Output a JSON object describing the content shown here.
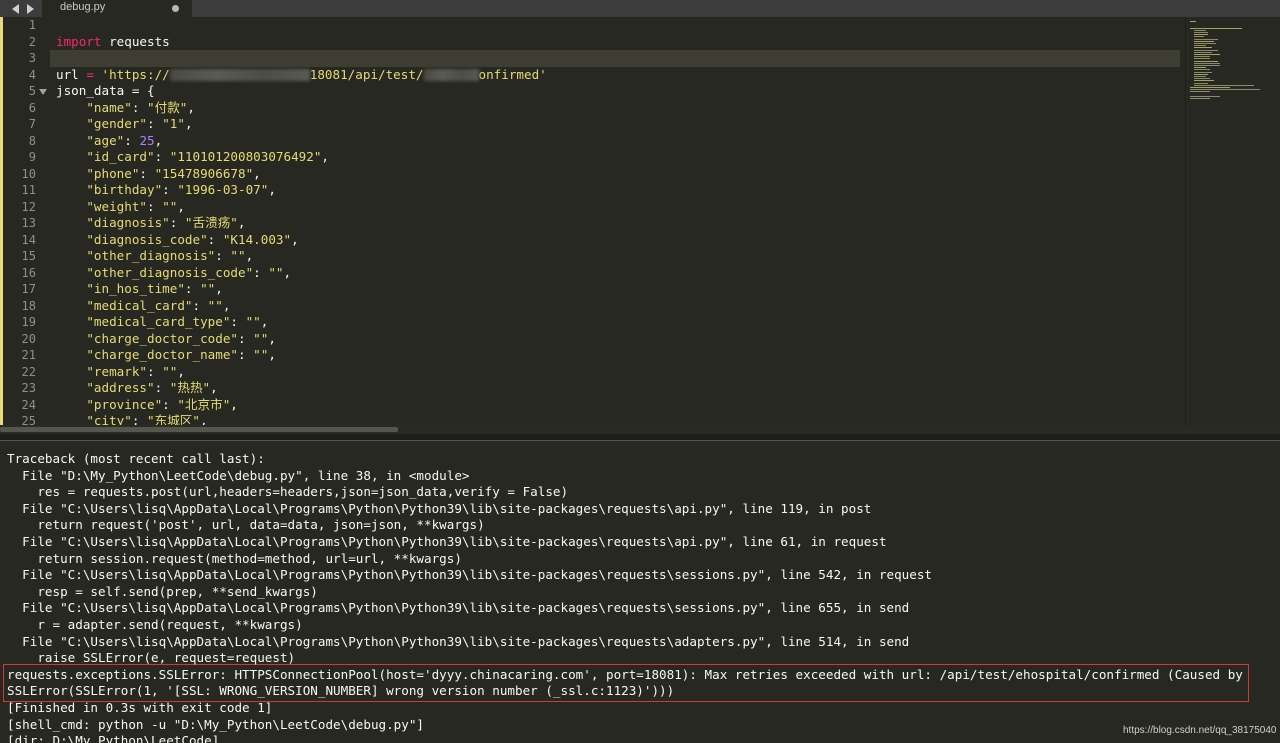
{
  "tab": {
    "filename": "debug.py"
  },
  "editor": {
    "line_numbers": [
      "1",
      "2",
      "3",
      "4",
      "5",
      "6",
      "7",
      "8",
      "9",
      "10",
      "11",
      "12",
      "13",
      "14",
      "15",
      "16",
      "17",
      "18",
      "19",
      "20",
      "21",
      "22",
      "23",
      "24",
      "25"
    ],
    "code": {
      "import_kw": "import",
      "import_mod": " requests",
      "url_var": "url ",
      "url_eq": "=",
      "url_open": " 'https://",
      "url_mid": "18081/api/test/",
      "url_end": "onfirmed'",
      "json_var": "json_data = {",
      "f_name_k": "\"name\"",
      "f_name_v": "\"付款\"",
      "f_gender_k": "\"gender\"",
      "f_gender_v": "\"1\"",
      "f_age_k": "\"age\"",
      "f_age_v": "25",
      "f_idcard_k": "\"id_card\"",
      "f_idcard_v": "\"110101200803076492\"",
      "f_phone_k": "\"phone\"",
      "f_phone_v": "\"15478906678\"",
      "f_birthday_k": "\"birthday\"",
      "f_birthday_v": "\"1996-03-07\"",
      "f_weight_k": "\"weight\"",
      "f_weight_v": "\"\"",
      "f_diag_k": "\"diagnosis\"",
      "f_diag_v": "\"舌溃疡\"",
      "f_diagcode_k": "\"diagnosis_code\"",
      "f_diagcode_v": "\"K14.003\"",
      "f_odiag_k": "\"other_diagnosis\"",
      "f_odiag_v": "\"\"",
      "f_odiagcode_k": "\"other_diagnosis_code\"",
      "f_odiagcode_v": "\"\"",
      "f_inhos_k": "\"in_hos_time\"",
      "f_inhos_v": "\"\"",
      "f_medcard_k": "\"medical_card\"",
      "f_medcard_v": "\"\"",
      "f_medcardtype_k": "\"medical_card_type\"",
      "f_medcardtype_v": "\"\"",
      "f_chdoccode_k": "\"charge_doctor_code\"",
      "f_chdoccode_v": "\"\"",
      "f_chdocname_k": "\"charge_doctor_name\"",
      "f_chdocname_v": "\"\"",
      "f_remark_k": "\"remark\"",
      "f_remark_v": "\"\"",
      "f_address_k": "\"address\"",
      "f_address_v": "\"热热\"",
      "f_province_k": "\"province\"",
      "f_province_v": "\"北京市\"",
      "f_city_k": "\"city\"",
      "f_city_v": "\"东城区\""
    }
  },
  "output": {
    "lines": [
      "Traceback (most recent call last):",
      "  File \"D:\\My_Python\\LeetCode\\debug.py\", line 38, in <module>",
      "    res = requests.post(url,headers=headers,json=json_data,verify = False)",
      "  File \"C:\\Users\\lisq\\AppData\\Local\\Programs\\Python\\Python39\\lib\\site-packages\\requests\\api.py\", line 119, in post",
      "    return request('post', url, data=data, json=json, **kwargs)",
      "  File \"C:\\Users\\lisq\\AppData\\Local\\Programs\\Python\\Python39\\lib\\site-packages\\requests\\api.py\", line 61, in request",
      "    return session.request(method=method, url=url, **kwargs)",
      "  File \"C:\\Users\\lisq\\AppData\\Local\\Programs\\Python\\Python39\\lib\\site-packages\\requests\\sessions.py\", line 542, in request",
      "    resp = self.send(prep, **send_kwargs)",
      "  File \"C:\\Users\\lisq\\AppData\\Local\\Programs\\Python\\Python39\\lib\\site-packages\\requests\\sessions.py\", line 655, in send",
      "    r = adapter.send(request, **kwargs)",
      "  File \"C:\\Users\\lisq\\AppData\\Local\\Programs\\Python\\Python39\\lib\\site-packages\\requests\\adapters.py\", line 514, in send",
      "    raise SSLError(e, request=request)",
      "requests.exceptions.SSLError: HTTPSConnectionPool(host='dyyy.chinacaring.com', port=18081): Max retries exceeded with url: /api/test/ehospital/confirmed (Caused by",
      "SSLError(SSLError(1, '[SSL: WRONG_VERSION_NUMBER] wrong version number (_ssl.c:1123)')))",
      "[Finished in 0.3s with exit code 1]",
      "[shell_cmd: python -u \"D:\\My_Python\\LeetCode\\debug.py\"]",
      "[dir: D:\\My_Python\\LeetCode]"
    ],
    "watermark": "https://blog.csdn.net/qq_38175040"
  },
  "colors": {
    "background": "#272822",
    "keyword": "#f92672",
    "string": "#e6db74",
    "number": "#ae81ff",
    "error_box": "#d9343a"
  },
  "icons": [
    "nav-left-icon",
    "nav-right-icon",
    "tab-modified-dot-icon",
    "fold-arrow-icon"
  ]
}
